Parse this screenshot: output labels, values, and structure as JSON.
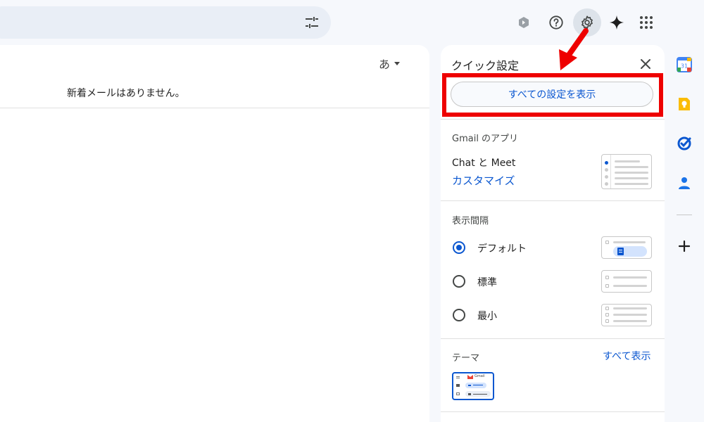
{
  "header": {
    "icons": [
      "filter-icon",
      "gemini-extension-icon",
      "help-icon",
      "settings-icon",
      "gemini-spark-icon",
      "apps-grid-icon"
    ]
  },
  "mail": {
    "language_picker": "あ",
    "empty_message": "新着メールはありません。"
  },
  "quick_settings": {
    "title": "クイック設定",
    "see_all_settings": "すべての設定を表示",
    "gmail_apps": {
      "label": "Gmail のアプリ",
      "chat_meet": "Chat と Meet",
      "customize": "カスタマイズ"
    },
    "density": {
      "label": "表示間隔",
      "options": [
        {
          "label": "デフォルト",
          "checked": true
        },
        {
          "label": "標準",
          "checked": false
        },
        {
          "label": "最小",
          "checked": false
        }
      ]
    },
    "theme": {
      "label": "テーマ",
      "see_all": "すべて表示",
      "thumb_text": "Gmail"
    }
  },
  "side_rail": {
    "icons": [
      "calendar-icon",
      "keep-icon",
      "tasks-icon",
      "contacts-icon",
      "add-icon"
    ],
    "calendar_day": "31"
  },
  "colors": {
    "accent": "#0b57d0",
    "highlight": "#ee0000"
  }
}
